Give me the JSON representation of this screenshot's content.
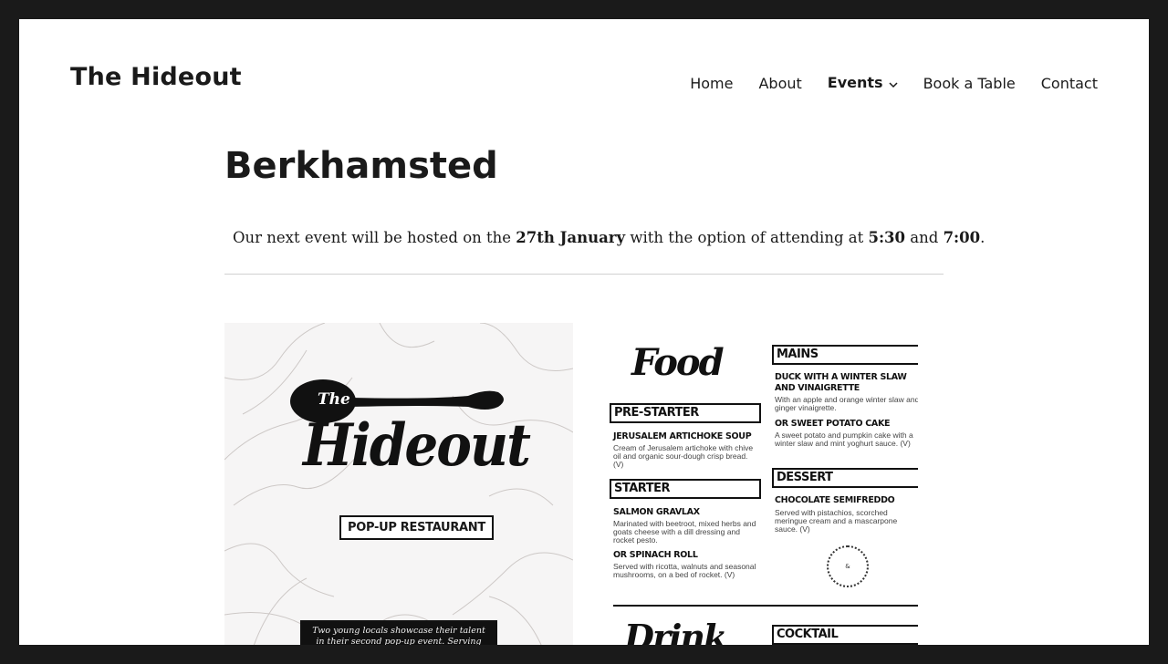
{
  "site": {
    "title": "The Hideout"
  },
  "nav": {
    "items": [
      {
        "label": "Home"
      },
      {
        "label": "About"
      },
      {
        "label": "Events"
      },
      {
        "label": "Book a Table"
      },
      {
        "label": "Contact"
      }
    ]
  },
  "entry": {
    "title": "Berkhamsted",
    "intro": {
      "part1": "Our next event will be hosted on the ",
      "date": "27th January",
      "part2": " with the option of attending at ",
      "time1": "5:30",
      "part3": " and ",
      "time2": "7:00",
      "part4": "."
    }
  },
  "menu_image": {
    "cover": {
      "the": "The",
      "brand": "Hideout",
      "badge": "POP-UP RESTAURANT",
      "blurb": "Two young locals showcase their talent in their second pop-up event. Serving fine, fresh, seasonal"
    },
    "food_heading": "Food",
    "drink_heading": "Drink",
    "stamp": "&",
    "sections": {
      "pre_starter": {
        "title": "PRE-STARTER",
        "dishes": [
          {
            "name": "JERUSALEM ARTICHOKE SOUP",
            "desc": "Cream of Jerusalem artichoke with chive oil and organic sour-dough crisp bread. (V)"
          }
        ]
      },
      "starter": {
        "title": "STARTER",
        "dishes": [
          {
            "name": "SALMON GRAVLAX",
            "desc": "Marinated with beetroot, mixed herbs and goats cheese with a dill dressing and rocket pesto."
          },
          {
            "name": "OR SPINACH ROLL",
            "desc": "Served with ricotta, walnuts and seasonal mushrooms, on a bed of rocket. (V)"
          }
        ]
      },
      "mains": {
        "title": "MAINS",
        "dishes": [
          {
            "name": "DUCK WITH A WINTER SLAW AND VINAIGRETTE",
            "desc": "With an apple and orange winter slaw and ginger vinaigrette."
          },
          {
            "name": "OR SWEET POTATO CAKE",
            "desc": "A sweet potato and pumpkin cake with a winter slaw and mint yoghurt sauce. (V)"
          }
        ]
      },
      "dessert": {
        "title": "DESSERT",
        "dishes": [
          {
            "name": "CHOCOLATE SEMIFREDDO",
            "desc": "Served with pistachios, scorched meringue cream and a mascarpone sauce. (V)"
          }
        ]
      },
      "cocktail": {
        "title": "COCKTAIL"
      }
    }
  },
  "colors": {
    "frame": "#1a1a1a",
    "background": "#ffffff",
    "text": "#1a1a1a",
    "divider": "#d1d1d1"
  }
}
